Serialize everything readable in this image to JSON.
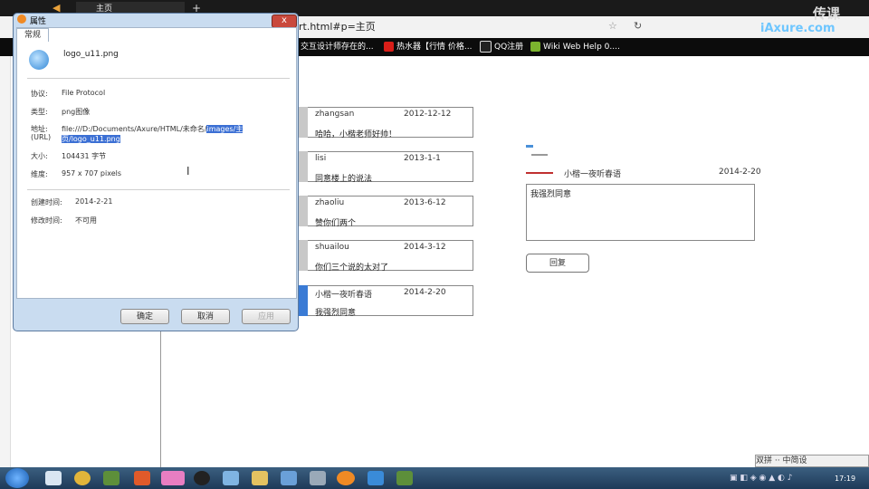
{
  "browser": {
    "tab_label": "主页",
    "new_tab_symbol": "+",
    "address": "rt.html#p=主页",
    "bookmarks": [
      "交互设计师存在的...",
      "热水器【行情 价格...",
      "QQ注册",
      "Wiki Web Help 0...."
    ]
  },
  "watermark": {
    "line1": "传课",
    "line2": "iAxure.com"
  },
  "dialog": {
    "title": "属性",
    "tab": "常规",
    "filename": "logo_u11.png",
    "fields": [
      {
        "label": "协议:",
        "value": "File Protocol"
      },
      {
        "label": "类型:",
        "value": "png图像"
      },
      {
        "label": "地址:",
        "label2": "(URL)",
        "value_normal": "file:///D:/Documents/Axure/HTML/未命名/",
        "value_selected": "images/主",
        "value_selected2": "页/logo_u11.png"
      },
      {
        "label": "大小:",
        "value": "104431  字节"
      },
      {
        "label": "维度:",
        "value": "957 x 707  pixels"
      }
    ],
    "created_label": "创建时间:",
    "created_value": "2014-2-21",
    "modified_label": "修改时间:",
    "modified_value": "不可用",
    "buttons": {
      "ok": "确定",
      "cancel": "取消",
      "apply": "应用"
    },
    "close": "x"
  },
  "comments": [
    {
      "name": "zhangsan",
      "date": "2012-12-12",
      "text": "哈哈，小楷老师好帅！"
    },
    {
      "name": "lisi",
      "date": "2013-1-1",
      "text": "同意楼上的说法"
    },
    {
      "name": "zhaoliu",
      "date": "2013-6-12",
      "text": "赞你们两个"
    },
    {
      "name": "shuailou",
      "date": "2014-3-12",
      "text": "你们三个说的太对了"
    },
    {
      "name": "小楷一夜听春语",
      "date": "2014-2-20",
      "text": "我强烈同意"
    }
  ],
  "reply": {
    "name": "小楷一夜听春语",
    "date": "2014-2-20",
    "text": "我强烈同意",
    "button": "回复"
  },
  "ime": "双拼 ·· 中简设",
  "clock": "17:19",
  "colors": {
    "taskbar": "#1e3a58",
    "selection": "#3b6fd4",
    "close": "#c9493d"
  }
}
